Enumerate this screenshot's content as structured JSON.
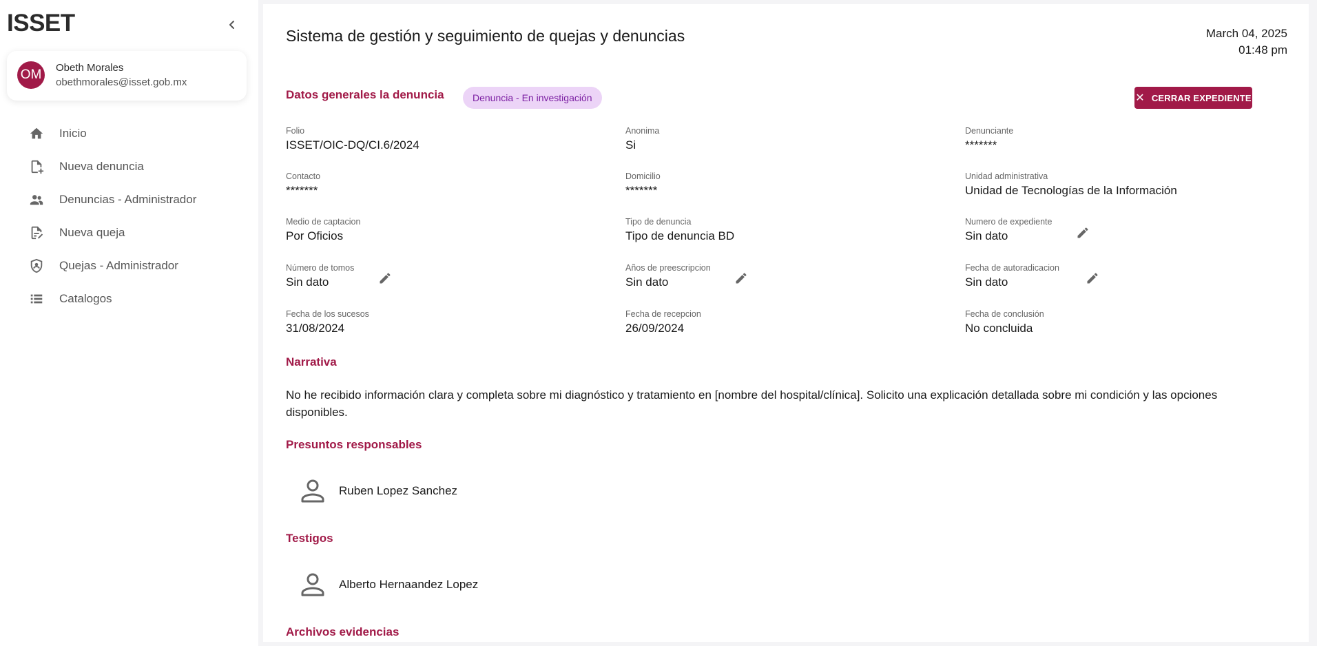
{
  "sidebar": {
    "logo": "ISSET",
    "user": {
      "initials": "OM",
      "name": "Obeth Morales",
      "email": "obethmorales@isset.gob.mx"
    },
    "items": [
      {
        "label": "Inicio",
        "icon": "home-icon"
      },
      {
        "label": "Nueva denuncia",
        "icon": "note-add-icon"
      },
      {
        "label": "Denuncias - Administrador",
        "icon": "group-icon"
      },
      {
        "label": "Nueva queja",
        "icon": "edit-note-icon"
      },
      {
        "label": "Quejas - Administrador",
        "icon": "shield-user-icon"
      },
      {
        "label": "Catalogos",
        "icon": "list-icon"
      }
    ]
  },
  "header": {
    "title": "Sistema de gestión y seguimiento de quejas y denuncias",
    "date": "March 04, 2025",
    "time": "01:48 pm"
  },
  "general": {
    "title": "Datos generales la denuncia",
    "status_badge": "Denuncia - En investigación",
    "close_button": "CERRAR EXPEDIENTE",
    "fields": [
      {
        "label": "Folio",
        "value": "ISSET/OIC-DQ/CI.6/2024"
      },
      {
        "label": "Anonima",
        "value": "Si"
      },
      {
        "label": "Denunciante",
        "value": "*******"
      },
      {
        "label": "Contacto",
        "value": "*******"
      },
      {
        "label": "Domicilio",
        "value": "*******"
      },
      {
        "label": "Unidad administrativa",
        "value": "Unidad de Tecnologías de la Información"
      },
      {
        "label": "Medio de captacion",
        "value": "Por Oficios"
      },
      {
        "label": "Tipo de denuncia",
        "value": "Tipo de denuncia BD"
      },
      {
        "label": "Numero de expediente",
        "value": "Sin dato"
      },
      {
        "label": "Número de tomos",
        "value": "Sin dato"
      },
      {
        "label": "Años de preescripcion",
        "value": "Sin dato"
      },
      {
        "label": "Fecha de autoradicacion",
        "value": "Sin dato"
      },
      {
        "label": "Fecha de los sucesos",
        "value": "31/08/2024"
      },
      {
        "label": "Fecha de recepcion",
        "value": "26/09/2024"
      },
      {
        "label": "Fecha de conclusión",
        "value": "No concluida"
      }
    ]
  },
  "narrative": {
    "title": "Narrativa",
    "text": "No he recibido información clara y completa sobre mi diagnóstico y tratamiento en [nombre del hospital/clínica]. Solicito una explicación detallada sobre mi condición y las opciones disponibles."
  },
  "responsables": {
    "title": "Presuntos responsables",
    "items": [
      "Ruben Lopez Sanchez"
    ]
  },
  "testigos": {
    "title": "Testigos",
    "items": [
      "Alberto Hernaandez Lopez"
    ]
  },
  "evidencias": {
    "title": "Archivos evidencias"
  }
}
